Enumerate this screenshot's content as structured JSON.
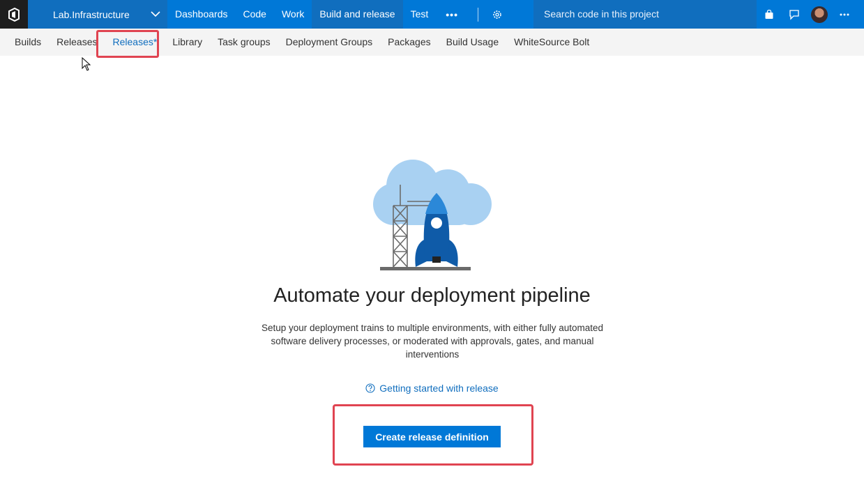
{
  "topbar": {
    "project_name": "Lab.Infrastructure",
    "nav": [
      {
        "label": "Dashboards"
      },
      {
        "label": "Code"
      },
      {
        "label": "Work"
      },
      {
        "label": "Build and release"
      },
      {
        "label": "Test"
      }
    ],
    "more_label": "•••",
    "search_placeholder": "Search code in this project",
    "icons": [
      "vsts-logo-icon",
      "chevron-down-icon",
      "gear-icon",
      "shopping-bag-icon",
      "feedback-icon",
      "avatar",
      "more-icon"
    ]
  },
  "subnav": {
    "items": [
      {
        "label": "Builds"
      },
      {
        "label": "Releases"
      },
      {
        "label": "Releases*"
      },
      {
        "label": "Library"
      },
      {
        "label": "Task groups"
      },
      {
        "label": "Deployment Groups"
      },
      {
        "label": "Packages"
      },
      {
        "label": "Build Usage"
      },
      {
        "label": "WhiteSource Bolt"
      }
    ]
  },
  "main": {
    "headline": "Automate your deployment pipeline",
    "description": "Setup your deployment trains to multiple environments, with either fully automated software delivery processes, or moderated with approvals, gates, and manual interventions",
    "help_link": "Getting started with release",
    "create_button": "Create release definition"
  },
  "colors": {
    "brand": "#0078d7",
    "brand_dark": "#106ebe",
    "highlight": "#e04451"
  }
}
